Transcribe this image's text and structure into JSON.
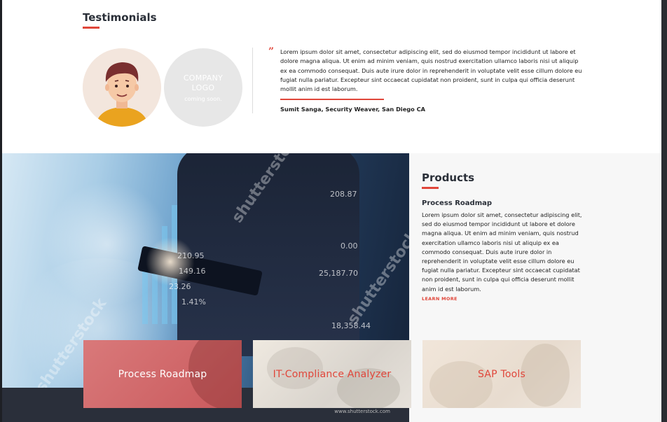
{
  "testimonials": {
    "title": "Testimonials",
    "company_logo": {
      "line1": "COMPANY",
      "line2": "LOGO",
      "line3": "coming soon."
    },
    "quote_mark": "”",
    "text": "Lorem ipsum dolor sit amet, consectetur adipiscing elit, sed do eiusmod tempor incididunt ut labore et dolore magna aliqua. Ut enim ad minim veniam, quis nostrud exercitation ullamco laboris nisi ut aliquip ex ea commodo consequat. Duis aute irure dolor in reprehenderit in voluptate velit esse cillum dolore eu fugiat nulla pariatur. Excepteur sint occaecat cupidatat non proident, sunt in culpa qui officia deserunt mollit anim id est laborum.",
    "author": "Sumit Sanga, Security Weaver, San Diego CA"
  },
  "hero": {
    "numbers": [
      "208.87",
      "210.95",
      "149.16",
      "23.26",
      "1.41%",
      "0.00",
      "25,187.70",
      "18,358.44"
    ],
    "watermark": "shutterstock",
    "watermark_url": "www.shutterstock.com"
  },
  "products": {
    "title": "Products",
    "subtitle": "Process Roadmap",
    "text": "Lorem ipsum dolor sit amet, consectetur adipiscing elit, sed do eiusmod tempor incididunt ut labore et dolore magna aliqua. Ut enim ad minim veniam, quis nostrud exercitation ullamco laboris nisi ut aliquip ex ea commodo consequat. Duis aute irure dolor in reprehenderit in voluptate velit esse cillum dolore eu fugiat nulla pariatur. Excepteur sint occaecat cupidatat non proident, sunt in culpa qui officia deserunt mollit anim id est laborum.",
    "learn_more": "LEARN MORE"
  },
  "cards": [
    {
      "label": "Process Roadmap"
    },
    {
      "label": "IT-Compliance Analyzer"
    },
    {
      "label": "SAP Tools"
    }
  ],
  "colors": {
    "accent": "#e0463a",
    "heading": "#2a2f38",
    "dark": "#2a2f3a"
  }
}
